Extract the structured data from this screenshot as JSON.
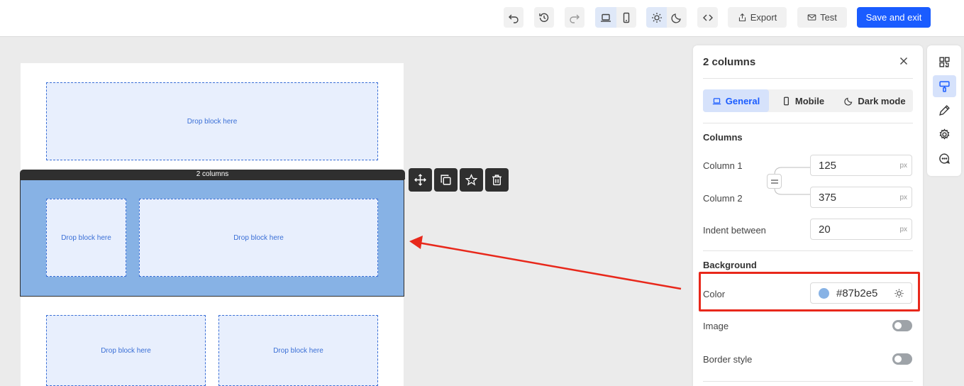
{
  "toolbar": {
    "export_label": "Export",
    "test_label": "Test",
    "save_label": "Save and exit"
  },
  "canvas": {
    "drop_text": "Drop block here",
    "selected_label": "2 columns"
  },
  "panel": {
    "title": "2 columns",
    "tabs": [
      "General",
      "Mobile",
      "Dark mode"
    ],
    "columns_heading": "Columns",
    "column1_label": "Column 1",
    "column1_value": "125",
    "column2_label": "Column 2",
    "column2_value": "375",
    "indent_label": "Indent between",
    "indent_value": "20",
    "unit": "px",
    "background_heading": "Background",
    "color_label": "Color",
    "color_value": "#87b2e5",
    "image_label": "Image",
    "border_label": "Border style"
  },
  "colors": {
    "accent": "#1a5cff",
    "block_background": "#87b2e5",
    "highlight": "#e8281b"
  }
}
